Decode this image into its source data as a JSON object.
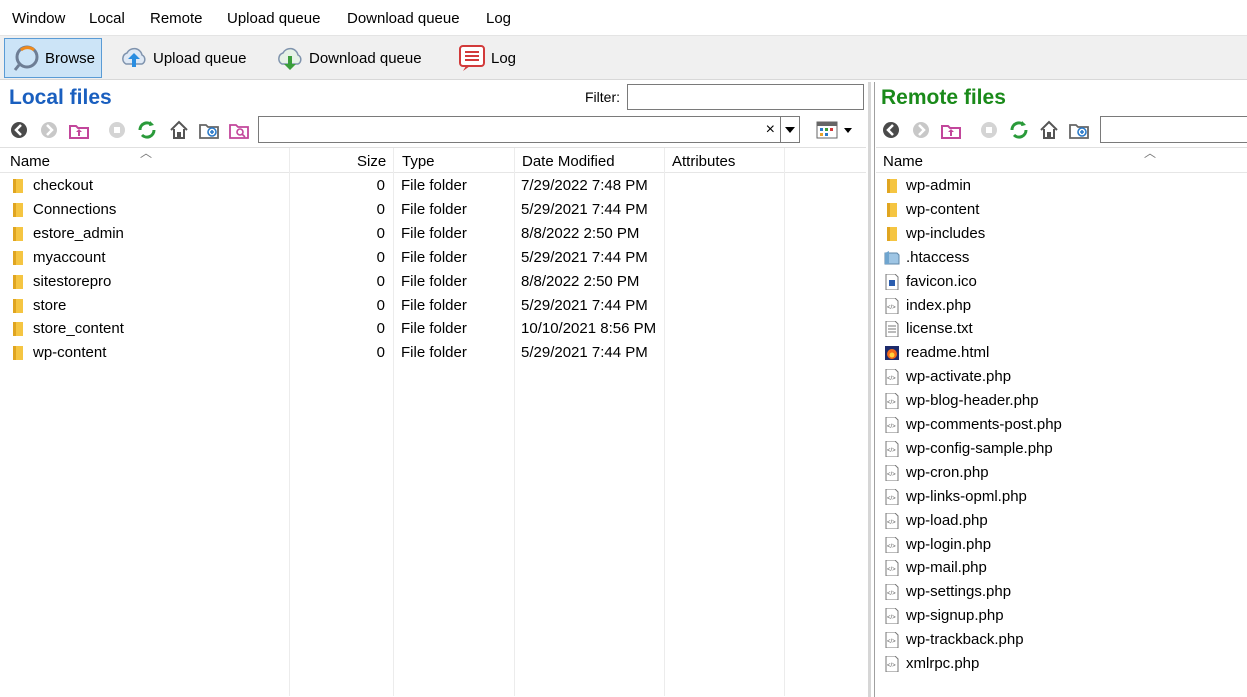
{
  "menu": [
    "Window",
    "Local",
    "Remote",
    "Upload queue",
    "Download queue",
    "Log"
  ],
  "toolbar": {
    "browse": "Browse",
    "upload_queue": "Upload queue",
    "download_queue": "Download queue",
    "log": "Log"
  },
  "local": {
    "title": "Local files",
    "filter_label": "Filter:",
    "filter_value": "",
    "path_value": "",
    "clear_symbol": "×",
    "columns": {
      "name": "Name",
      "size": "Size",
      "type": "Type",
      "date": "Date Modified",
      "attributes": "Attributes"
    },
    "files": [
      {
        "name": "checkout",
        "size": "0",
        "type": "File folder",
        "date": "7/29/2022 7:48 PM",
        "icon": "folder-icon"
      },
      {
        "name": "Connections",
        "size": "0",
        "type": "File folder",
        "date": "5/29/2021 7:44 PM",
        "icon": "folder-icon"
      },
      {
        "name": "estore_admin",
        "size": "0",
        "type": "File folder",
        "date": "8/8/2022 2:50 PM",
        "icon": "folder-icon"
      },
      {
        "name": "myaccount",
        "size": "0",
        "type": "File folder",
        "date": "5/29/2021 7:44 PM",
        "icon": "folder-icon"
      },
      {
        "name": "sitestorepro",
        "size": "0",
        "type": "File folder",
        "date": "8/8/2022 2:50 PM",
        "icon": "folder-icon"
      },
      {
        "name": "store",
        "size": "0",
        "type": "File folder",
        "date": "5/29/2021 7:44 PM",
        "icon": "folder-icon"
      },
      {
        "name": "store_content",
        "size": "0",
        "type": "File folder",
        "date": "10/10/2021 8:56 PM",
        "icon": "folder-icon"
      },
      {
        "name": "wp-content",
        "size": "0",
        "type": "File folder",
        "date": "5/29/2021 7:44 PM",
        "icon": "folder-icon"
      }
    ]
  },
  "remote": {
    "title": "Remote files",
    "path_value": "",
    "columns": {
      "name": "Name"
    },
    "files": [
      {
        "name": "wp-admin",
        "icon": "folder-icon"
      },
      {
        "name": "wp-content",
        "icon": "folder-icon"
      },
      {
        "name": "wp-includes",
        "icon": "folder-icon"
      },
      {
        "name": ".htaccess",
        "icon": "htaccess-file-icon"
      },
      {
        "name": "favicon.ico",
        "icon": "image-file-icon"
      },
      {
        "name": "index.php",
        "icon": "php-file-icon"
      },
      {
        "name": "license.txt",
        "icon": "text-file-icon"
      },
      {
        "name": "readme.html",
        "icon": "html-file-icon"
      },
      {
        "name": "wp-activate.php",
        "icon": "php-file-icon"
      },
      {
        "name": "wp-blog-header.php",
        "icon": "php-file-icon"
      },
      {
        "name": "wp-comments-post.php",
        "icon": "php-file-icon"
      },
      {
        "name": "wp-config-sample.php",
        "icon": "php-file-icon"
      },
      {
        "name": "wp-cron.php",
        "icon": "php-file-icon"
      },
      {
        "name": "wp-links-opml.php",
        "icon": "php-file-icon"
      },
      {
        "name": "wp-load.php",
        "icon": "php-file-icon"
      },
      {
        "name": "wp-login.php",
        "icon": "php-file-icon"
      },
      {
        "name": "wp-mail.php",
        "icon": "php-file-icon"
      },
      {
        "name": "wp-settings.php",
        "icon": "php-file-icon"
      },
      {
        "name": "wp-signup.php",
        "icon": "php-file-icon"
      },
      {
        "name": "wp-trackback.php",
        "icon": "php-file-icon"
      },
      {
        "name": "xmlrpc.php",
        "icon": "php-file-icon"
      }
    ]
  },
  "colors": {
    "local_title": "#1a5fbf",
    "remote_title": "#1a8a1a",
    "active_tab_bg": "#cce4f7",
    "folder": "#f5c542"
  }
}
